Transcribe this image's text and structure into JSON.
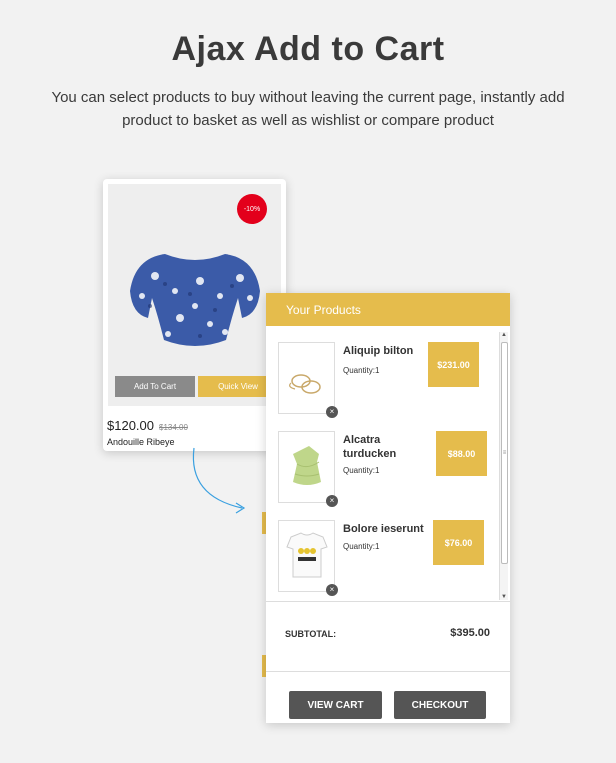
{
  "headline": "Ajax Add to Cart",
  "subline": "You can select products to buy without leaving the current page, instantly add product to basket as well as wishlist or compare product",
  "card": {
    "badge": "-10%",
    "add_label": "Add To Cart",
    "quick_label": "Quick View",
    "price": "$120.00",
    "old_price": "$134.00",
    "name": "Andouille Ribeye",
    "heart_icon": "heart-icon"
  },
  "cart": {
    "title": "Your Products",
    "items": [
      {
        "name": "Aliquip bilton",
        "quantity": "Quantity:1",
        "price": "$231.00"
      },
      {
        "name": "Alcatra turducken",
        "quantity": "Quantity:1",
        "price": "$88.00"
      },
      {
        "name": "Bolore ieserunt",
        "quantity": "Quantity:1",
        "price": "$76.00"
      }
    ],
    "subtotal_label": "SUBTOTAL:",
    "subtotal_value": "$395.00",
    "view_cart_label": "VIEW CART",
    "checkout_label": "CHECKOUT"
  },
  "colors": {
    "accent": "#e5bc4c",
    "sale": "#e3001b",
    "dark_button": "#555555"
  }
}
